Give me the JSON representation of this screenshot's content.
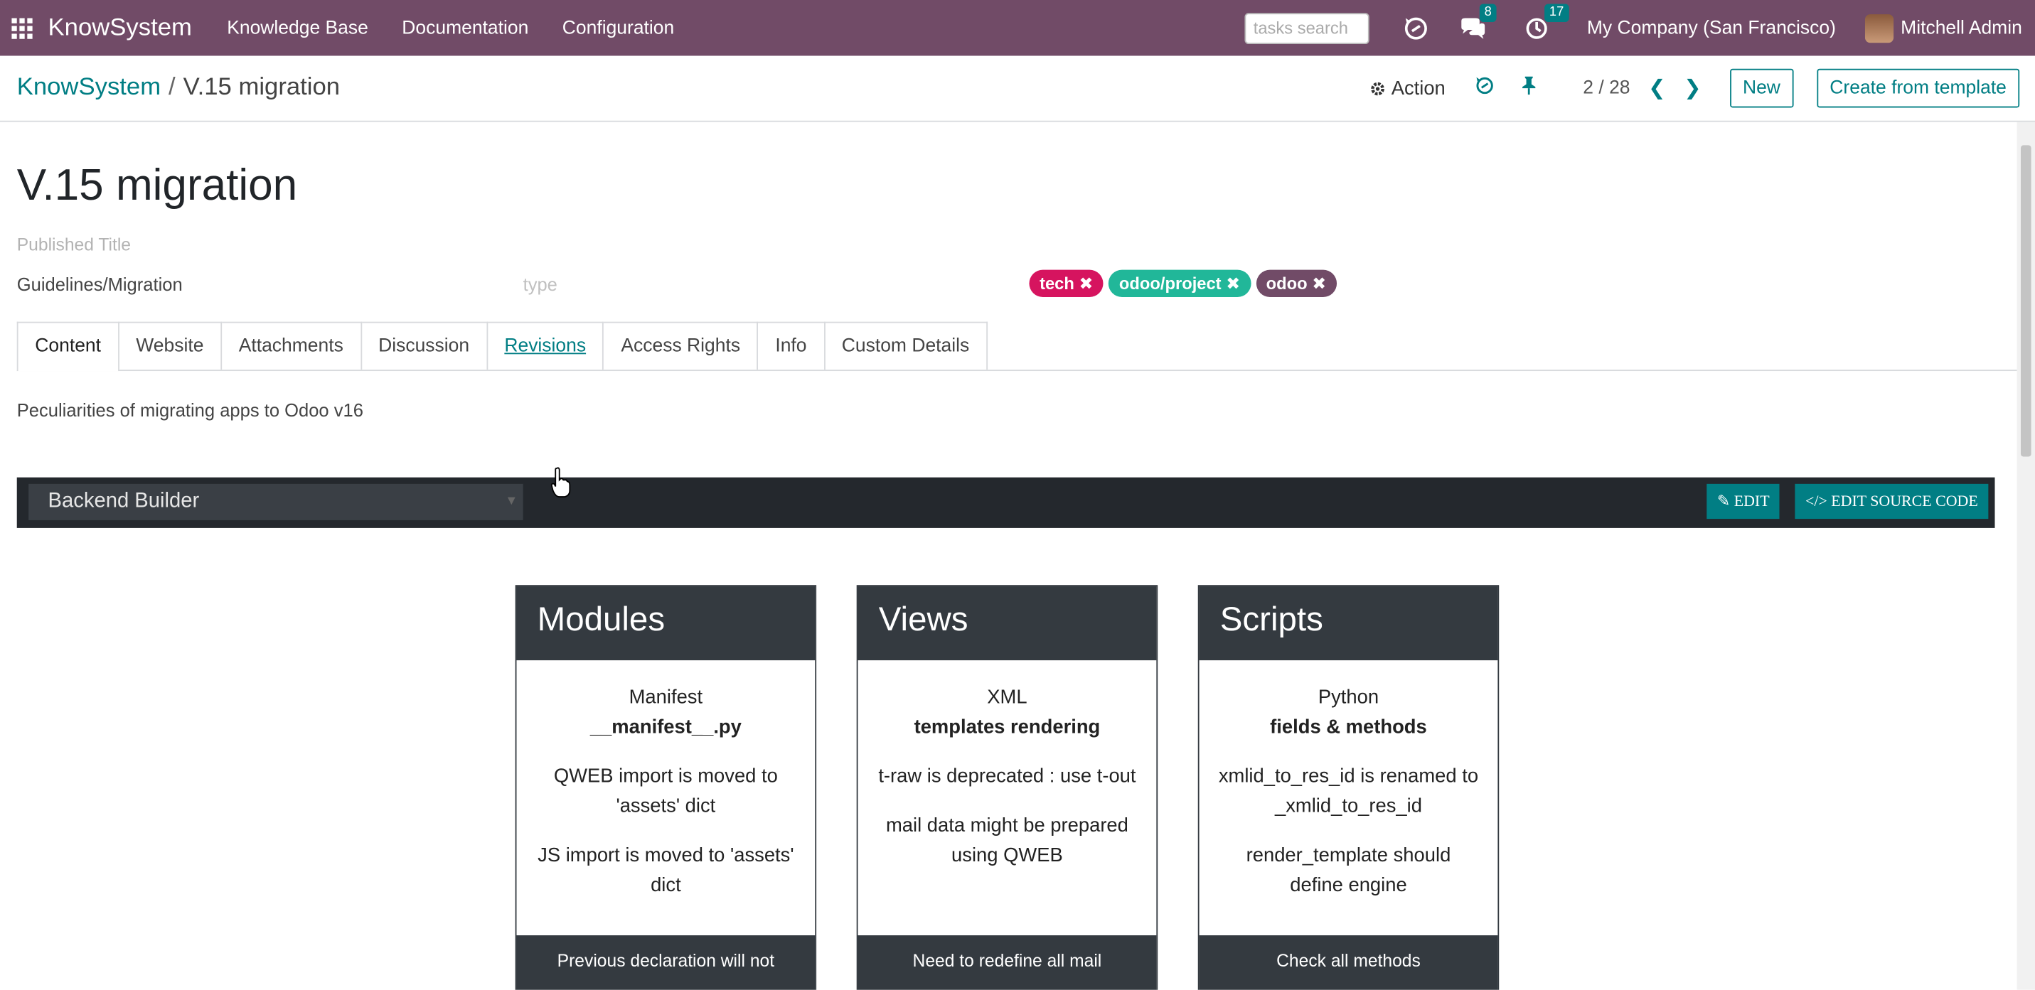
{
  "topbar": {
    "brand": "KnowSystem",
    "menu": [
      "Knowledge Base",
      "Documentation",
      "Configuration"
    ],
    "search_placeholder": "tasks search",
    "messages_count": "8",
    "activities_count": "17",
    "company": "My Company (San Francisco)",
    "user": "Mitchell Admin"
  },
  "controlbar": {
    "breadcrumb_root": "KnowSystem",
    "breadcrumb_sep": "/",
    "breadcrumb_current": "V.15 migration",
    "action_label": "Action",
    "pager": "2 / 28",
    "new_label": "New",
    "template_label": "Create from template"
  },
  "record": {
    "title": "V.15 migration",
    "published_title_placeholder": "Published Title",
    "section": "Guidelines/Migration",
    "type_placeholder": "type",
    "tags": [
      {
        "label": "tech",
        "color": "#d6145f"
      },
      {
        "label": "odoo/project",
        "color": "#21b799"
      },
      {
        "label": "odoo",
        "color": "#714b67"
      }
    ]
  },
  "tabs": [
    "Content",
    "Website",
    "Attachments",
    "Discussion",
    "Revisions",
    "Access Rights",
    "Info",
    "Custom Details"
  ],
  "content": {
    "description": "Peculiarities of migrating apps to Odoo v16",
    "builder_select": "Backend Builder",
    "edit_label": "EDIT",
    "edit_source_label": "EDIT SOURCE CODE",
    "cards": [
      {
        "title": "Modules",
        "line1": "Manifest",
        "line1_bold": "__manifest__.py",
        "p2": "QWEB import is moved to 'assets' dict",
        "p3": "JS import is moved to 'assets' dict",
        "footer": "Previous declaration will not"
      },
      {
        "title": "Views",
        "line1": "XML",
        "line1_bold": "templates rendering",
        "p2": "t-raw is deprecated : use t-out",
        "p3": "mail data might be prepared using QWEB",
        "footer": "Need to redefine all mail"
      },
      {
        "title": "Scripts",
        "line1": "Python",
        "line1_bold": "fields & methods",
        "p2": "xmlid_to_res_id is renamed to _xmlid_to_res_id",
        "p3": "render_template should define engine",
        "footer": "Check all methods"
      }
    ]
  },
  "colors": {
    "brand": "#714b67",
    "accent": "#017e84",
    "dark": "#343a40"
  }
}
